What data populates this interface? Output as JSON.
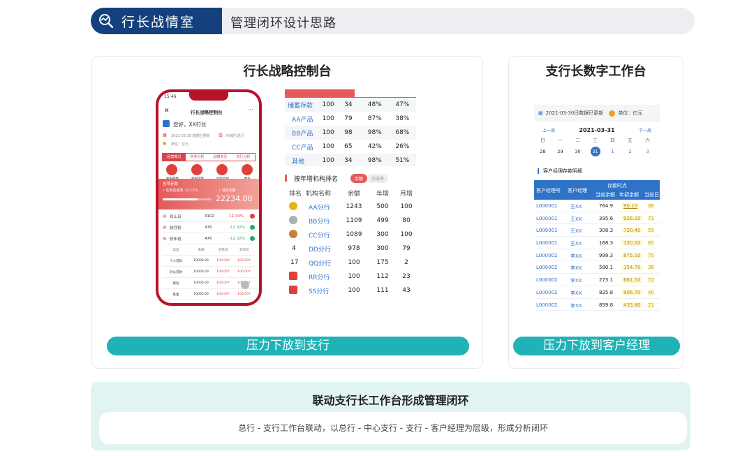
{
  "header": {
    "badge_title": "行长战情室",
    "subtitle": "管理闭环设计思路"
  },
  "left_card": {
    "title": "行长战略控制台",
    "button": "压力下放到支行"
  },
  "right_card": {
    "title": "支行长数字工作台",
    "button": "压力下放到客户经理"
  },
  "phone": {
    "time": "15:46",
    "title": "行长战略控制台",
    "greeting": "您好，XX行长",
    "updated": "2021-03-29 数据已更新",
    "unit": "单位：亿元",
    "branch_tag": "XX银行总行",
    "tabs": [
      "经营概况",
      "财务分析",
      "战略关注",
      "支行分析"
    ],
    "quick": [
      "机构存款",
      "机构贷款",
      "风险监控",
      "更多"
    ],
    "band_label": "各项存款",
    "band_rate": "• 任务完成率 72.12%",
    "band_balance_label": "• 当前余额",
    "band_value": "22234.00",
    "stats": [
      {
        "label": "较上日",
        "value": "3102",
        "pct": "12.34%"
      },
      {
        "label": "较月初",
        "value": "476",
        "pct": "-12.32%"
      },
      {
        "label": "较年初",
        "value": "476",
        "pct": "-12.32%"
      }
    ],
    "table_header": [
      "类型",
      "余额",
      "较昨日",
      "较年初"
    ],
    "table_rows": [
      [
        "个人贷款",
        "10000.00",
        "100.00↑",
        "100.00↑"
      ],
      [
        "对公贷款",
        "10000.00",
        "100.00↑",
        "100.00↑"
      ],
      [
        "保险",
        "10000.00",
        "100.00↑",
        "100.00↑"
      ],
      [
        "基金",
        "10000.00",
        "100.00↑",
        "100.00↑"
      ]
    ]
  },
  "product_table": {
    "rows": [
      [
        "储蓄存款",
        "100",
        "34",
        "48%",
        "47%"
      ],
      [
        "AA产品",
        "100",
        "79",
        "87%",
        "38%"
      ],
      [
        "BB产品",
        "100",
        "98",
        "98%",
        "68%"
      ],
      [
        "CC产品",
        "100",
        "65",
        "42%",
        "26%"
      ],
      [
        "其他",
        "100",
        "34",
        "98%",
        "51%"
      ]
    ]
  },
  "ranking": {
    "title": "按年增机构排名",
    "toggle_on": "余额",
    "toggle_off": "完成率",
    "headers": [
      "排名",
      "机构名称",
      "余额",
      "年增",
      "月增"
    ],
    "rows": [
      [
        "1",
        "AA分行",
        "1243",
        "500",
        "100"
      ],
      [
        "2",
        "BB分行",
        "1109",
        "499",
        "80"
      ],
      [
        "3",
        "CC分行",
        "1089",
        "300",
        "100"
      ],
      [
        "4",
        "DD分行",
        "978",
        "300",
        "79"
      ],
      [
        "17",
        "QQ分行",
        "100",
        "175",
        "2"
      ],
      [
        "18",
        "RR分行",
        "100",
        "112",
        "23"
      ],
      [
        "19",
        "SS分行",
        "100",
        "111",
        "43"
      ]
    ]
  },
  "workbench": {
    "updated": "2021-03-30日数据已更新",
    "unit": "单位：亿元",
    "prev": "上一周",
    "date": "2021-03-31",
    "next": "下一周",
    "weekdays": [
      "日",
      "一",
      "二",
      "三",
      "四",
      "五",
      "六"
    ],
    "days": [
      "28",
      "29",
      "30",
      "31",
      "1",
      "2",
      "3"
    ],
    "section": "客户经理存款明细",
    "head_top": "存款时点",
    "headers": [
      "客户经理号",
      "客户经理",
      "当前余额",
      "年初余额",
      "当前日"
    ],
    "rows": [
      [
        "L000001",
        "王XX",
        "764.9",
        "90.10",
        "36"
      ],
      [
        "L000001",
        "王XX",
        "395.6",
        "926.10",
        "71"
      ],
      [
        "L000001",
        "王XX",
        "308.3",
        "730.40",
        "55"
      ],
      [
        "L000001",
        "王XX",
        "168.3",
        "130.10",
        "85"
      ],
      [
        "L000002",
        "李XX",
        "999.3",
        "875.10",
        "75"
      ],
      [
        "L000002",
        "李XX",
        "580.1",
        "154.70",
        "36"
      ],
      [
        "L000002",
        "李XX",
        "273.1",
        "661.10",
        "72"
      ],
      [
        "L000002",
        "李XX",
        "825.8",
        "906.70",
        "40"
      ],
      [
        "L000002",
        "李XX",
        "859.8",
        "433.80",
        "21"
      ]
    ]
  },
  "bottom": {
    "title": "联动支行长工作台形成管理闭环",
    "desc": "总行 - 支行工作台联动，以总行 - 中心支行 - 支行 - 客户经理为层级，形成分析闭环"
  }
}
